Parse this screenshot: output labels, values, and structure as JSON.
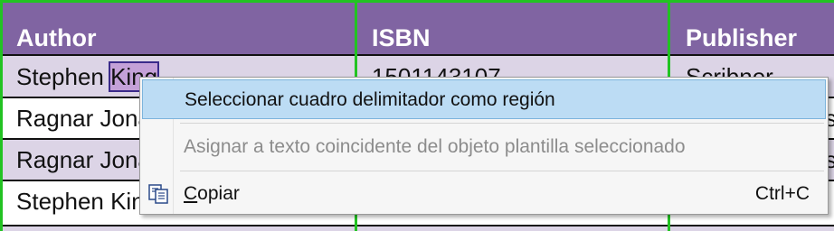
{
  "table": {
    "headers": [
      "Author",
      "ISBN",
      "Publisher"
    ],
    "rows": [
      {
        "author_a": "Stephen ",
        "author_b": "King",
        "isbn": "1501143107",
        "publisher": "Scribner"
      },
      {
        "author": "Ragnar Jonasson",
        "isbn": "",
        "publisher": "s"
      },
      {
        "author": "Ragnar Jonasson",
        "isbn": "",
        "publisher": "s"
      },
      {
        "author": "Stephen King",
        "isbn": "",
        "publisher": ""
      }
    ]
  },
  "context_menu": {
    "items": [
      {
        "label": "Seleccionar cuadro delimitador como región",
        "state": "selected"
      },
      {
        "label": "Asignar a texto coincidente del objeto plantilla seleccionado",
        "state": "disabled"
      },
      {
        "label": "Copiar",
        "mnemonic": "C",
        "rest": "opiar",
        "shortcut": "Ctrl+C",
        "icon": "copy-icon"
      }
    ]
  },
  "colors": {
    "header_bg": "#8064a2",
    "row_alt_bg": "#dcd4e6",
    "grid_green": "#22c322",
    "menu_selected": "#bcdcf4"
  }
}
